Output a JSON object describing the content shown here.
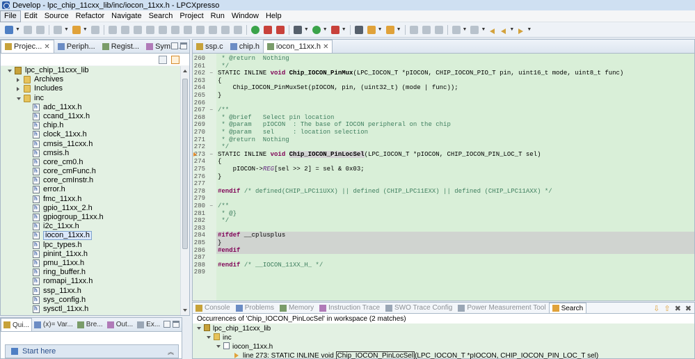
{
  "window": {
    "title": "Develop - lpc_chip_11cxx_lib/inc/iocon_11xx.h - LPCXpresso"
  },
  "menubar": [
    "File",
    "Edit",
    "Source",
    "Refactor",
    "Navigate",
    "Search",
    "Project",
    "Run",
    "Window",
    "Help"
  ],
  "left_panel": {
    "tabs": [
      {
        "label": "Projec...",
        "active": true
      },
      {
        "label": "Periph..."
      },
      {
        "label": "Regist..."
      },
      {
        "label": "Symb..."
      }
    ],
    "tree": [
      {
        "label": "lpc_chip_11cxx_lib",
        "indent": 0,
        "kind": "project",
        "open": true
      },
      {
        "label": "Archives",
        "indent": 1,
        "kind": "folder",
        "open": false
      },
      {
        "label": "Includes",
        "indent": 1,
        "kind": "folder",
        "open": false
      },
      {
        "label": "inc",
        "indent": 1,
        "kind": "folder",
        "open": true
      },
      {
        "label": "adc_11xx.h",
        "indent": 2,
        "kind": "file"
      },
      {
        "label": "ccand_11xx.h",
        "indent": 2,
        "kind": "file"
      },
      {
        "label": "chip.h",
        "indent": 2,
        "kind": "file"
      },
      {
        "label": "clock_11xx.h",
        "indent": 2,
        "kind": "file"
      },
      {
        "label": "cmsis_11cxx.h",
        "indent": 2,
        "kind": "file"
      },
      {
        "label": "cmsis.h",
        "indent": 2,
        "kind": "file"
      },
      {
        "label": "core_cm0.h",
        "indent": 2,
        "kind": "file"
      },
      {
        "label": "core_cmFunc.h",
        "indent": 2,
        "kind": "file"
      },
      {
        "label": "core_cmInstr.h",
        "indent": 2,
        "kind": "file"
      },
      {
        "label": "error.h",
        "indent": 2,
        "kind": "file"
      },
      {
        "label": "fmc_11xx.h",
        "indent": 2,
        "kind": "file"
      },
      {
        "label": "gpio_11xx_2.h",
        "indent": 2,
        "kind": "file"
      },
      {
        "label": "gpiogroup_11xx.h",
        "indent": 2,
        "kind": "file"
      },
      {
        "label": "i2c_11xx.h",
        "indent": 2,
        "kind": "file"
      },
      {
        "label": "iocon_11xx.h",
        "indent": 2,
        "kind": "file",
        "selected": true
      },
      {
        "label": "lpc_types.h",
        "indent": 2,
        "kind": "file"
      },
      {
        "label": "pinint_11xx.h",
        "indent": 2,
        "kind": "file"
      },
      {
        "label": "pmu_11xx.h",
        "indent": 2,
        "kind": "file"
      },
      {
        "label": "ring_buffer.h",
        "indent": 2,
        "kind": "file"
      },
      {
        "label": "romapi_11xx.h",
        "indent": 2,
        "kind": "file"
      },
      {
        "label": "ssp_11xx.h",
        "indent": 2,
        "kind": "file"
      },
      {
        "label": "sys_config.h",
        "indent": 2,
        "kind": "file"
      },
      {
        "label": "sysctl_11xx.h",
        "indent": 2,
        "kind": "file"
      }
    ]
  },
  "bottom_left_panel": {
    "tabs": [
      {
        "label": "Qui...",
        "active": true
      },
      {
        "label": "(x)= Var..."
      },
      {
        "label": "Bre..."
      },
      {
        "label": "Out..."
      },
      {
        "label": "Ex..."
      }
    ],
    "start_here": "Start here"
  },
  "editor": {
    "tabs": [
      {
        "label": "ssp.c"
      },
      {
        "label": "chip.h"
      },
      {
        "label": "iocon_11xx.h",
        "active": true
      }
    ],
    "lines": [
      {
        "n": "260",
        "html": "<span class='cm'> * @return  Nothing</span>"
      },
      {
        "n": "261",
        "html": "<span class='cm'> */</span>"
      },
      {
        "n": "262",
        "fold": "⊖",
        "html": "STATIC INLINE <span class='kw'>void</span> <span class='fn'>Chip_IOCON_PinMux</span>(LPC_IOCON_T *pIOCON, CHIP_IOCON_PIO_T pin, uint16_t mode, uint8_t func)"
      },
      {
        "n": "263",
        "html": "{"
      },
      {
        "n": "264",
        "html": "    Chip_IOCON_PinMuxSet(pIOCON, pin, (uint32_t) (mode | func));"
      },
      {
        "n": "265",
        "html": "}"
      },
      {
        "n": "266",
        "html": ""
      },
      {
        "n": "267",
        "fold": "⊖",
        "html": "<span class='cm'>/**</span>"
      },
      {
        "n": "268",
        "html": "<span class='cm'> * @brief   Select pin location</span>"
      },
      {
        "n": "269",
        "html": "<span class='cm'> * @param   pIOCON  : The base of IOCON peripheral on the chip</span>"
      },
      {
        "n": "270",
        "html": "<span class='cm'> * @param   sel     : location selection</span>"
      },
      {
        "n": "271",
        "html": "<span class='cm'> * @return  Nothing</span>"
      },
      {
        "n": "272",
        "html": "<span class='cm'> */</span>"
      },
      {
        "n": "273",
        "fold": "⊖",
        "current": true,
        "html": "STATIC INLINE <span class='kw'>void</span> <span class='fn occ'>Chip_IOCON_PinLocSel</span>(LPC_IOCON_T *pIOCON, CHIP_IOCON_PIN_LOC_T sel)"
      },
      {
        "n": "274",
        "html": "{"
      },
      {
        "n": "275",
        "html": "    pIOCON-&gt;<span class='mac'>REG</span>[sel &gt;&gt; 2] = sel &amp; 0x03;"
      },
      {
        "n": "276",
        "html": "}"
      },
      {
        "n": "277",
        "html": ""
      },
      {
        "n": "278",
        "html": "<span class='kw'>#endif</span> <span class='cm'>/* defined(CHIP_LPC11UXX) || defined (CHIP_LPC11EXX) || defined (CHIP_LPC11AXX) */</span>"
      },
      {
        "n": "279",
        "html": ""
      },
      {
        "n": "280",
        "fold": "⊖",
        "html": "<span class='cm'>/**</span>"
      },
      {
        "n": "281",
        "html": "<span class='cm'> * @}</span>"
      },
      {
        "n": "282",
        "html": "<span class='cm'> */</span>"
      },
      {
        "n": "283",
        "html": ""
      },
      {
        "n": "284",
        "html": "<span class='kw'>#ifdef</span> __cplusplus",
        "grey": true
      },
      {
        "n": "285",
        "html": "}",
        "grey": true
      },
      {
        "n": "286",
        "html": "<span class='kw'>#endif</span>",
        "grey": true
      },
      {
        "n": "287",
        "html": ""
      },
      {
        "n": "288",
        "html": "<span class='kw'>#endif</span> <span class='cm'>/* __IOCON_11XX_H_ */</span>"
      },
      {
        "n": "289",
        "html": ""
      }
    ]
  },
  "bottom_panel": {
    "tabs": [
      {
        "label": "Console"
      },
      {
        "label": "Problems"
      },
      {
        "label": "Memory"
      },
      {
        "label": "Instruction Trace"
      },
      {
        "label": "SWO Trace Config"
      },
      {
        "label": "Power Measurement Tool"
      },
      {
        "label": "Search",
        "active": true
      }
    ],
    "occurrences": "Occurrences of 'Chip_IOCON_PinLocSel' in workspace (2 matches)",
    "results": {
      "project": "lpc_chip_11cxx_lib",
      "folder": "inc",
      "file": "iocon_11xx.h",
      "match_prefix": "line 273:  STATIC INLINE void ",
      "match_hit": "Chip_IOCON_PinLocSel",
      "match_suffix": "(LPC_IOCON_T *pIOCON, CHIP_IOCON_PIN_LOC_T sel)"
    }
  },
  "colors": {
    "tree_bg": "#e3f1e3",
    "code_bg": "#d9efd8",
    "comment": "#3f7f5f",
    "keyword": "#7f0055"
  }
}
